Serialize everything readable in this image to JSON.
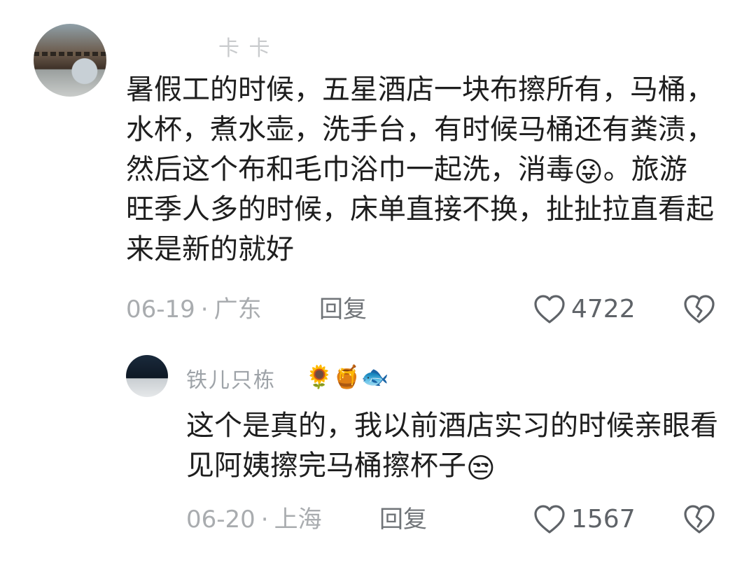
{
  "comments": [
    {
      "username": "卡  卡",
      "text_before_emoji": "暑假工的时候，五星酒店一块布擦所有，马桶，水杯，煮水壶，洗手台，有时候马桶还有粪渍，然后这个布和毛巾浴巾一起洗，消毒",
      "emoji": "😜",
      "text_after_emoji": "。旅游旺季人多的时候，床单直接不换，扯扯拉直看起来是新的就好",
      "date": "06-19",
      "location": "广东",
      "reply_label": "回复",
      "like_count": "4722",
      "icons": {
        "like": "heart-outline-icon",
        "dislike": "broken-heart-icon"
      }
    },
    {
      "username": "铁儿只栋",
      "username_emojis": "🌻🍯🐟",
      "text_before_emoji": "这个是真的，我以前酒店实习的时候亲眼看见阿姨擦完马桶擦杯子",
      "emoji": "😒",
      "text_after_emoji": "",
      "date": "06-20",
      "location": "上海",
      "reply_label": "回复",
      "like_count": "1567",
      "icons": {
        "like": "heart-outline-icon",
        "dislike": "broken-heart-icon"
      }
    }
  ],
  "separator": "·"
}
